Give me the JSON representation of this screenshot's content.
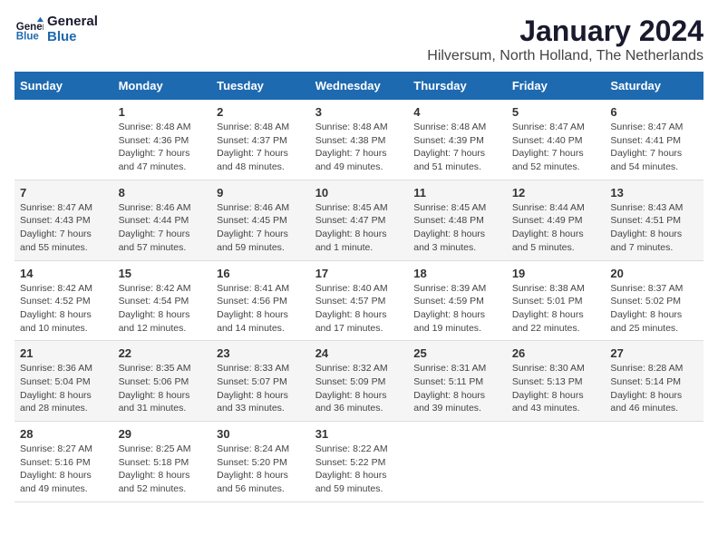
{
  "logo": {
    "line1": "General",
    "line2": "Blue"
  },
  "title": "January 2024",
  "subtitle": "Hilversum, North Holland, The Netherlands",
  "weekdays": [
    "Sunday",
    "Monday",
    "Tuesday",
    "Wednesday",
    "Thursday",
    "Friday",
    "Saturday"
  ],
  "weeks": [
    [
      {
        "day": "",
        "sunrise": "",
        "sunset": "",
        "daylight": ""
      },
      {
        "day": "1",
        "sunrise": "Sunrise: 8:48 AM",
        "sunset": "Sunset: 4:36 PM",
        "daylight": "Daylight: 7 hours and 47 minutes."
      },
      {
        "day": "2",
        "sunrise": "Sunrise: 8:48 AM",
        "sunset": "Sunset: 4:37 PM",
        "daylight": "Daylight: 7 hours and 48 minutes."
      },
      {
        "day": "3",
        "sunrise": "Sunrise: 8:48 AM",
        "sunset": "Sunset: 4:38 PM",
        "daylight": "Daylight: 7 hours and 49 minutes."
      },
      {
        "day": "4",
        "sunrise": "Sunrise: 8:48 AM",
        "sunset": "Sunset: 4:39 PM",
        "daylight": "Daylight: 7 hours and 51 minutes."
      },
      {
        "day": "5",
        "sunrise": "Sunrise: 8:47 AM",
        "sunset": "Sunset: 4:40 PM",
        "daylight": "Daylight: 7 hours and 52 minutes."
      },
      {
        "day": "6",
        "sunrise": "Sunrise: 8:47 AM",
        "sunset": "Sunset: 4:41 PM",
        "daylight": "Daylight: 7 hours and 54 minutes."
      }
    ],
    [
      {
        "day": "7",
        "sunrise": "Sunrise: 8:47 AM",
        "sunset": "Sunset: 4:43 PM",
        "daylight": "Daylight: 7 hours and 55 minutes."
      },
      {
        "day": "8",
        "sunrise": "Sunrise: 8:46 AM",
        "sunset": "Sunset: 4:44 PM",
        "daylight": "Daylight: 7 hours and 57 minutes."
      },
      {
        "day": "9",
        "sunrise": "Sunrise: 8:46 AM",
        "sunset": "Sunset: 4:45 PM",
        "daylight": "Daylight: 7 hours and 59 minutes."
      },
      {
        "day": "10",
        "sunrise": "Sunrise: 8:45 AM",
        "sunset": "Sunset: 4:47 PM",
        "daylight": "Daylight: 8 hours and 1 minute."
      },
      {
        "day": "11",
        "sunrise": "Sunrise: 8:45 AM",
        "sunset": "Sunset: 4:48 PM",
        "daylight": "Daylight: 8 hours and 3 minutes."
      },
      {
        "day": "12",
        "sunrise": "Sunrise: 8:44 AM",
        "sunset": "Sunset: 4:49 PM",
        "daylight": "Daylight: 8 hours and 5 minutes."
      },
      {
        "day": "13",
        "sunrise": "Sunrise: 8:43 AM",
        "sunset": "Sunset: 4:51 PM",
        "daylight": "Daylight: 8 hours and 7 minutes."
      }
    ],
    [
      {
        "day": "14",
        "sunrise": "Sunrise: 8:42 AM",
        "sunset": "Sunset: 4:52 PM",
        "daylight": "Daylight: 8 hours and 10 minutes."
      },
      {
        "day": "15",
        "sunrise": "Sunrise: 8:42 AM",
        "sunset": "Sunset: 4:54 PM",
        "daylight": "Daylight: 8 hours and 12 minutes."
      },
      {
        "day": "16",
        "sunrise": "Sunrise: 8:41 AM",
        "sunset": "Sunset: 4:56 PM",
        "daylight": "Daylight: 8 hours and 14 minutes."
      },
      {
        "day": "17",
        "sunrise": "Sunrise: 8:40 AM",
        "sunset": "Sunset: 4:57 PM",
        "daylight": "Daylight: 8 hours and 17 minutes."
      },
      {
        "day": "18",
        "sunrise": "Sunrise: 8:39 AM",
        "sunset": "Sunset: 4:59 PM",
        "daylight": "Daylight: 8 hours and 19 minutes."
      },
      {
        "day": "19",
        "sunrise": "Sunrise: 8:38 AM",
        "sunset": "Sunset: 5:01 PM",
        "daylight": "Daylight: 8 hours and 22 minutes."
      },
      {
        "day": "20",
        "sunrise": "Sunrise: 8:37 AM",
        "sunset": "Sunset: 5:02 PM",
        "daylight": "Daylight: 8 hours and 25 minutes."
      }
    ],
    [
      {
        "day": "21",
        "sunrise": "Sunrise: 8:36 AM",
        "sunset": "Sunset: 5:04 PM",
        "daylight": "Daylight: 8 hours and 28 minutes."
      },
      {
        "day": "22",
        "sunrise": "Sunrise: 8:35 AM",
        "sunset": "Sunset: 5:06 PM",
        "daylight": "Daylight: 8 hours and 31 minutes."
      },
      {
        "day": "23",
        "sunrise": "Sunrise: 8:33 AM",
        "sunset": "Sunset: 5:07 PM",
        "daylight": "Daylight: 8 hours and 33 minutes."
      },
      {
        "day": "24",
        "sunrise": "Sunrise: 8:32 AM",
        "sunset": "Sunset: 5:09 PM",
        "daylight": "Daylight: 8 hours and 36 minutes."
      },
      {
        "day": "25",
        "sunrise": "Sunrise: 8:31 AM",
        "sunset": "Sunset: 5:11 PM",
        "daylight": "Daylight: 8 hours and 39 minutes."
      },
      {
        "day": "26",
        "sunrise": "Sunrise: 8:30 AM",
        "sunset": "Sunset: 5:13 PM",
        "daylight": "Daylight: 8 hours and 43 minutes."
      },
      {
        "day": "27",
        "sunrise": "Sunrise: 8:28 AM",
        "sunset": "Sunset: 5:14 PM",
        "daylight": "Daylight: 8 hours and 46 minutes."
      }
    ],
    [
      {
        "day": "28",
        "sunrise": "Sunrise: 8:27 AM",
        "sunset": "Sunset: 5:16 PM",
        "daylight": "Daylight: 8 hours and 49 minutes."
      },
      {
        "day": "29",
        "sunrise": "Sunrise: 8:25 AM",
        "sunset": "Sunset: 5:18 PM",
        "daylight": "Daylight: 8 hours and 52 minutes."
      },
      {
        "day": "30",
        "sunrise": "Sunrise: 8:24 AM",
        "sunset": "Sunset: 5:20 PM",
        "daylight": "Daylight: 8 hours and 56 minutes."
      },
      {
        "day": "31",
        "sunrise": "Sunrise: 8:22 AM",
        "sunset": "Sunset: 5:22 PM",
        "daylight": "Daylight: 8 hours and 59 minutes."
      },
      {
        "day": "",
        "sunrise": "",
        "sunset": "",
        "daylight": ""
      },
      {
        "day": "",
        "sunrise": "",
        "sunset": "",
        "daylight": ""
      },
      {
        "day": "",
        "sunrise": "",
        "sunset": "",
        "daylight": ""
      }
    ]
  ]
}
